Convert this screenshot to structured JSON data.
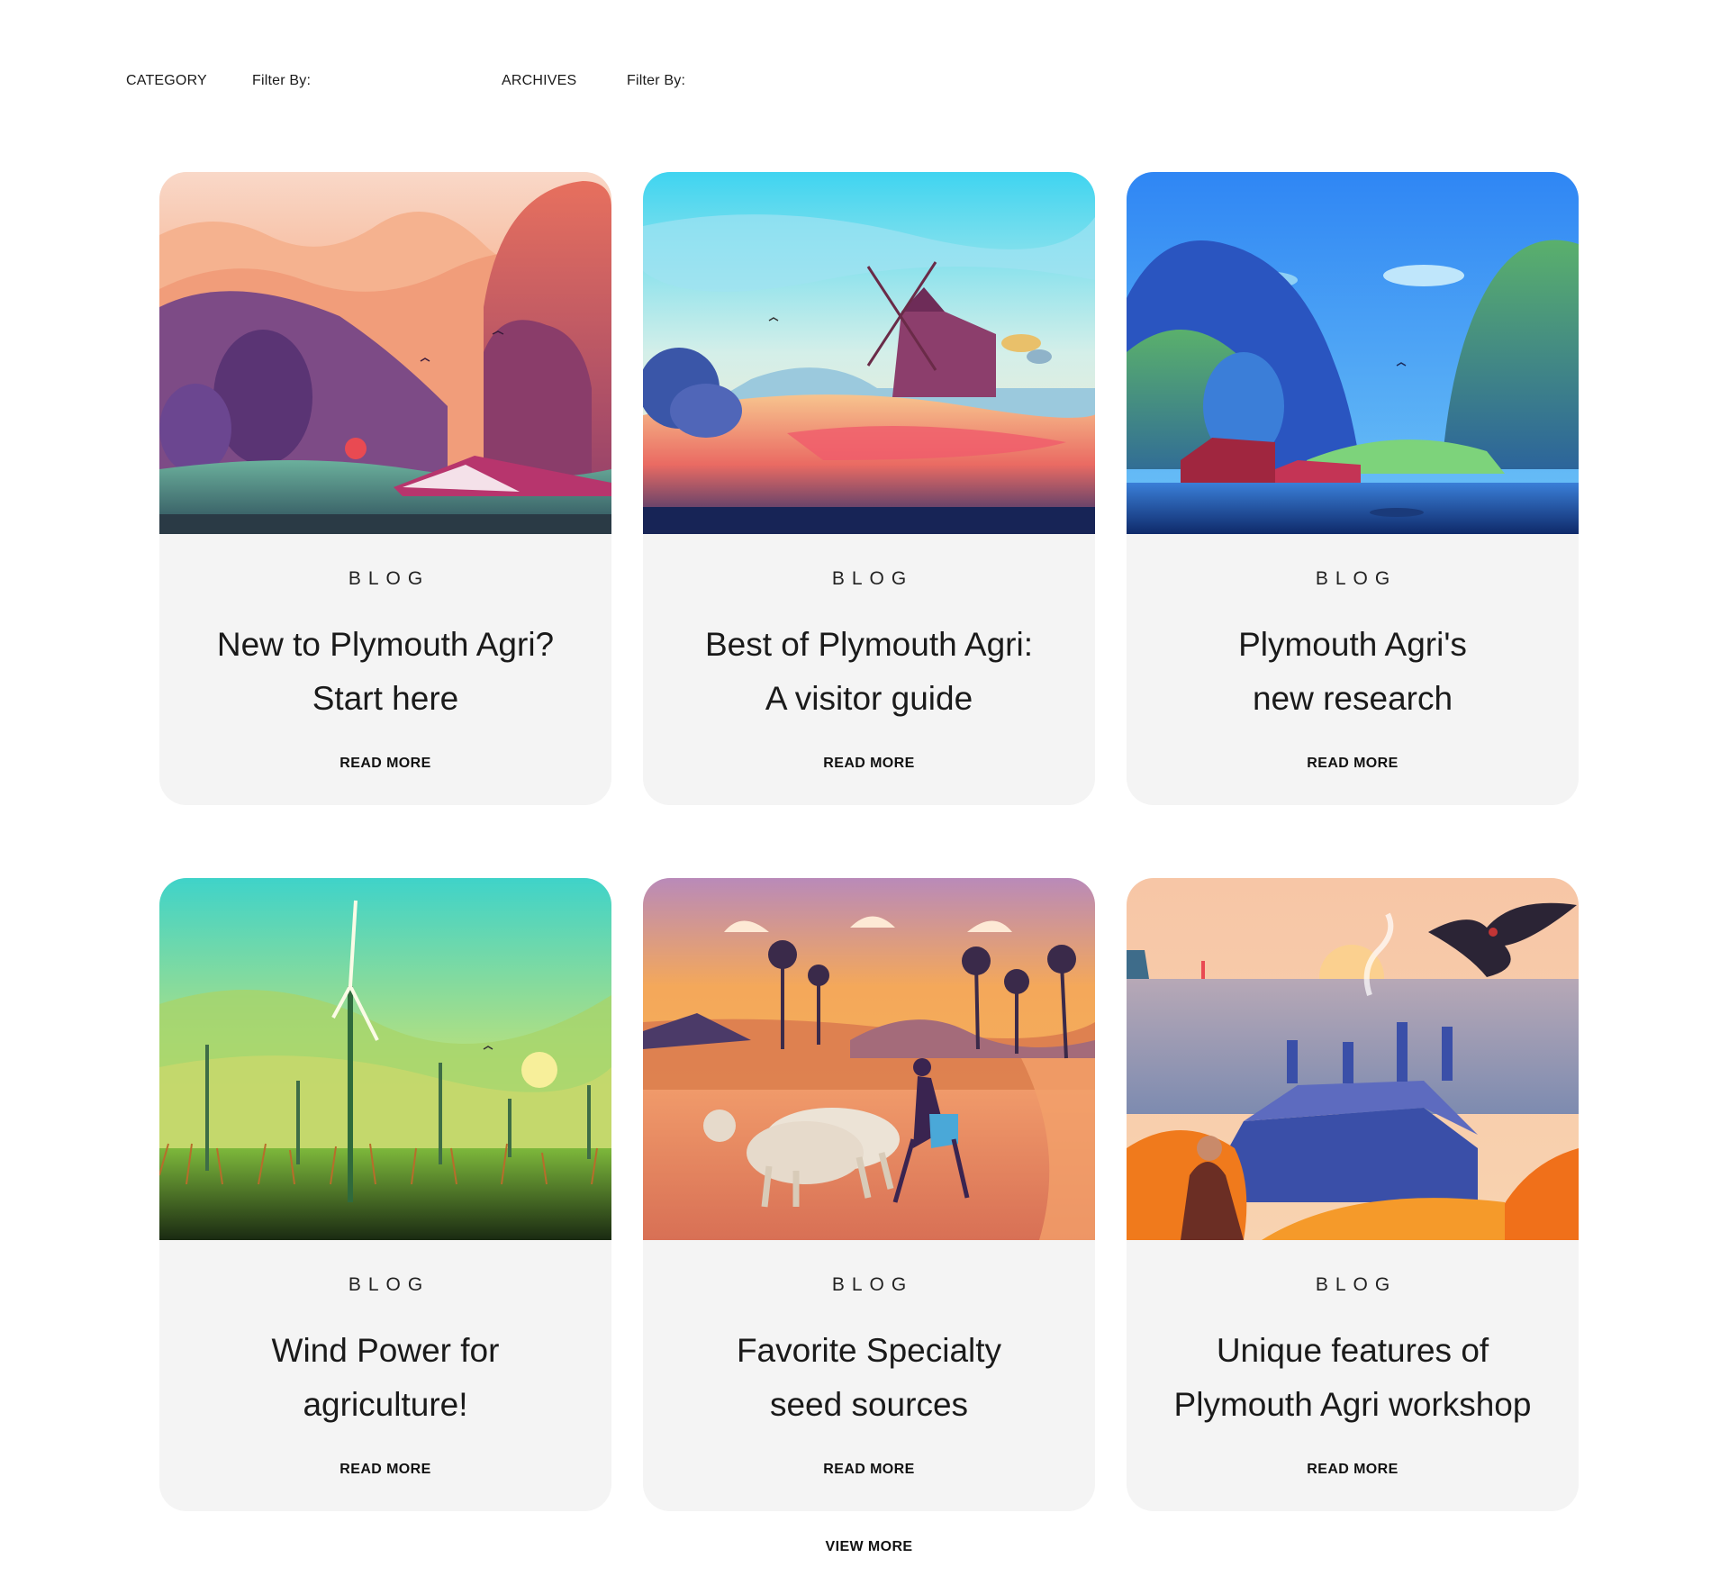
{
  "filters": {
    "category_label": "CATEGORY",
    "category_filter": "Filter By:",
    "archives_label": "ARCHIVES",
    "archives_filter": "Filter By:"
  },
  "posts": [
    {
      "category": "BLOG",
      "title_line1": "New to Plymouth Agri?",
      "title_line2": "Start here",
      "read_more": "READ MORE",
      "image_icon": "sunset-farm-hills-illustration"
    },
    {
      "category": "BLOG",
      "title_line1": "Best of Plymouth Agri:",
      "title_line2": "A visitor guide",
      "read_more": "READ MORE",
      "image_icon": "windmill-field-illustration"
    },
    {
      "category": "BLOG",
      "title_line1": "Plymouth Agri's",
      "title_line2": "new research",
      "read_more": "READ MORE",
      "image_icon": "blue-valley-barns-illustration"
    },
    {
      "category": "BLOG",
      "title_line1": "Wind Power for",
      "title_line2": "agriculture!",
      "read_more": "READ MORE",
      "image_icon": "wind-turbines-illustration"
    },
    {
      "category": "BLOG",
      "title_line1": "Favorite Specialty",
      "title_line2": "seed sources",
      "read_more": "READ MORE",
      "image_icon": "farmer-plowing-oxen-illustration"
    },
    {
      "category": "BLOG",
      "title_line1": "Unique features of",
      "title_line2": "Plymouth Agri workshop",
      "read_more": "READ MORE",
      "image_icon": "coastal-cottages-bird-illustration"
    }
  ],
  "view_more": "VIEW MORE"
}
